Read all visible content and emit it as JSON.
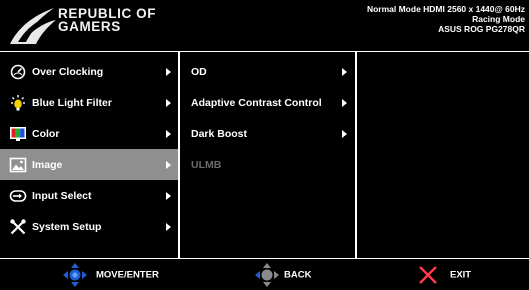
{
  "brand": {
    "line1": "REPUBLIC OF",
    "line2": "GAMERS"
  },
  "status": {
    "line1": "Normal Mode HDMI 2560 x 1440@ 60Hz",
    "line2": "Racing Mode",
    "line3": "ASUS ROG PG278QR"
  },
  "menu": {
    "main": [
      {
        "label": "Over Clocking",
        "icon": "overclock-icon"
      },
      {
        "label": "Blue Light Filter",
        "icon": "blue-light-icon"
      },
      {
        "label": "Color",
        "icon": "color-icon"
      },
      {
        "label": "Image",
        "icon": "image-icon",
        "selected": true
      },
      {
        "label": "Input Select",
        "icon": "input-select-icon"
      },
      {
        "label": "System Setup",
        "icon": "system-setup-icon"
      }
    ],
    "sub": [
      {
        "label": "OD",
        "enabled": true
      },
      {
        "label": "Adaptive Contrast Control",
        "enabled": true
      },
      {
        "label": "Dark Boost",
        "enabled": true
      },
      {
        "label": "ULMB",
        "enabled": false
      }
    ]
  },
  "footer": {
    "move_enter": "MOVE/ENTER",
    "back": "BACK",
    "exit": "EXIT"
  },
  "colors": {
    "selected_bg": "#8f8f8f",
    "accent_blue": "#1e5fd6",
    "exit_red": "#ff3b4a"
  }
}
